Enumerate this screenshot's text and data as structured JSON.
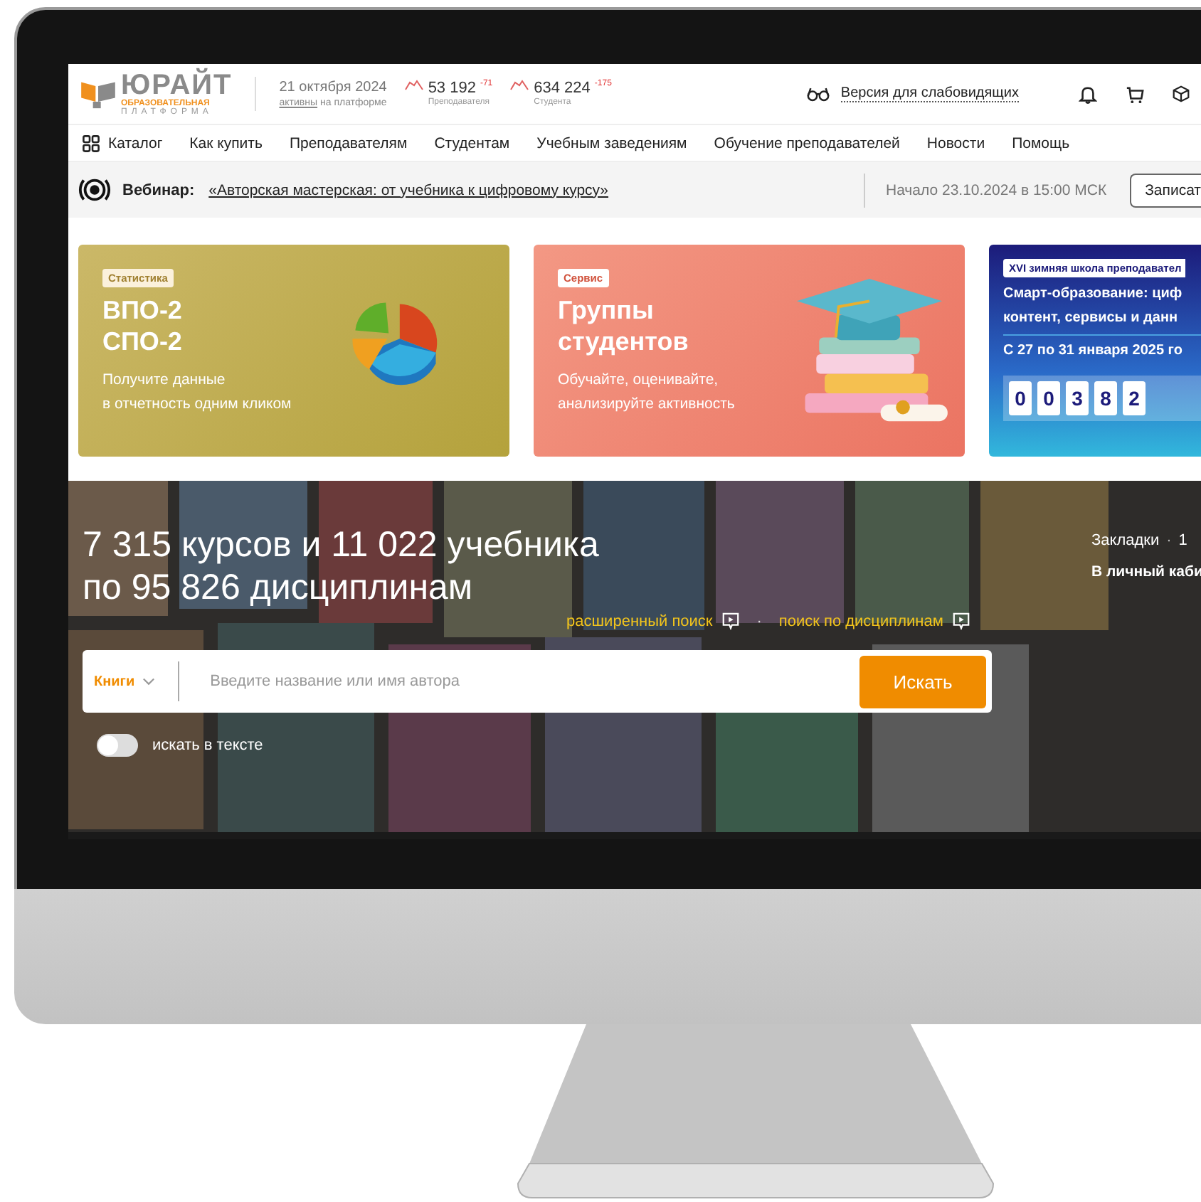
{
  "header": {
    "logo": {
      "name": "ЮРАЙТ",
      "tagline": "ОБРАЗОВАТЕЛЬНАЯ",
      "subtagline": "ПЛАТФОРМА"
    },
    "date": "21 октября 2024",
    "active_link": "активны",
    "active_text": "на платформе",
    "stats": [
      {
        "value": "53 192",
        "delta": "-71",
        "label": "Преподавателя"
      },
      {
        "value": "634 224",
        "delta": "-175",
        "label": "Студента"
      }
    ],
    "accessibility_link": "Версия для слабовидящих"
  },
  "nav": {
    "items": [
      {
        "label": "Каталог"
      },
      {
        "label": "Как купить"
      },
      {
        "label": "Преподавателям"
      },
      {
        "label": "Студентам"
      },
      {
        "label": "Учебным заведениям"
      },
      {
        "label": "Обучение преподавателей"
      },
      {
        "label": "Новости"
      },
      {
        "label": "Помощь"
      }
    ]
  },
  "webinar": {
    "label": "Вебинар:",
    "link": "«Авторская мастерская: от учебника к цифровому курсу»",
    "start": "Начало 23.10.2024 в 15:00 МСК",
    "button": "Записат"
  },
  "cards": [
    {
      "kind": "stats",
      "tag": "Статистика",
      "title_lines": [
        "ВПО-2",
        "СПО-2"
      ],
      "text_lines": [
        "Получите данные",
        "в отчетность одним кликом"
      ]
    },
    {
      "kind": "groups",
      "tag": "Сервис",
      "title_lines": [
        "Группы",
        "студентов"
      ],
      "text_lines": [
        "Обучайте, оценивайте,",
        "анализируйте активность"
      ]
    },
    {
      "kind": "event",
      "tag": "XVI зимняя школа преподавател",
      "title_lines": [
        "Смарт-образование: циф",
        "контент, сервисы и данн"
      ],
      "dates": "С 27 по 31 января 2025 го",
      "counter": [
        "0",
        "0",
        "3",
        "8",
        "2"
      ]
    }
  ],
  "hero": {
    "title_lines": [
      "7 315 курсов и 11 022 учебника",
      "по 95 826 дисциплинам"
    ],
    "links": [
      "расширенный поиск",
      "поиск по дисциплинам"
    ],
    "separator": "·",
    "search": {
      "category": "Книги",
      "placeholder": "Введите название или имя автора",
      "button": "Искать"
    },
    "text_search": {
      "label": "искать в тексте",
      "on": false
    },
    "bookmarks": "Закладки",
    "separator_2": "·",
    "bookmarks_count": "1",
    "cabinet": "В личный каби"
  }
}
